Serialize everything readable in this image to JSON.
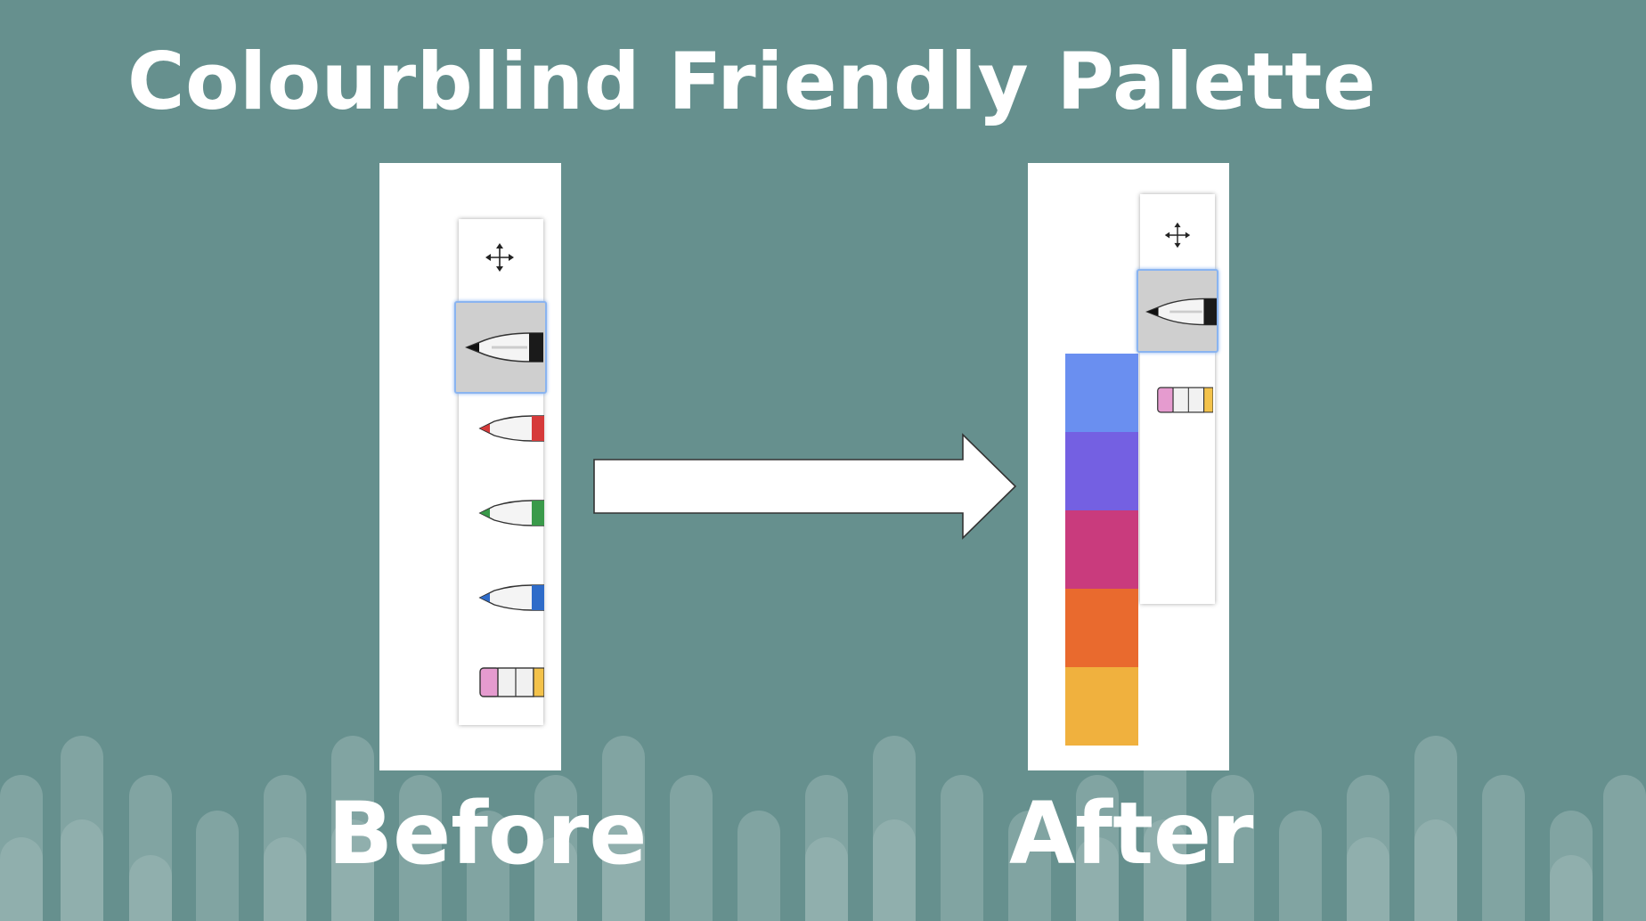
{
  "slide": {
    "title": "Colourblind Friendly Palette",
    "before_label": "Before",
    "after_label": "After"
  },
  "colors": {
    "background": "#66908e",
    "panel": "#ffffff",
    "selection": "#8ab4f0"
  },
  "before_toolbar": {
    "tools": [
      {
        "name": "move-handle-icon"
      },
      {
        "name": "black-pen-icon",
        "selected": true
      },
      {
        "name": "red-pen-icon",
        "color": "#d63a3a"
      },
      {
        "name": "green-pen-icon",
        "color": "#3a9a4a"
      },
      {
        "name": "blue-pen-icon",
        "color": "#2f6cc9"
      },
      {
        "name": "eraser-icon"
      }
    ]
  },
  "after_toolbar": {
    "tools": [
      {
        "name": "move-handle-icon"
      },
      {
        "name": "black-pen-icon",
        "selected": true
      },
      {
        "name": "eraser-icon"
      }
    ],
    "palette": [
      "#6a8ff0",
      "#7460e2",
      "#c93b7d",
      "#e96a2e",
      "#f0b13e"
    ]
  }
}
